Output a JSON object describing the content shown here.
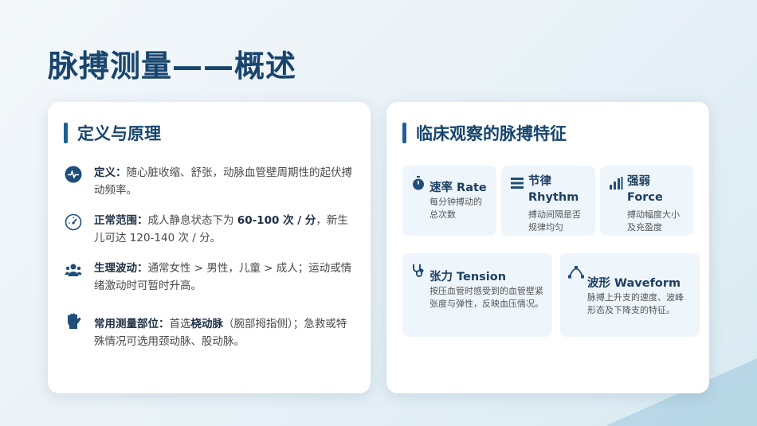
{
  "page": {
    "title": "脉搏测量——概述"
  },
  "left_card": {
    "heading": "定义与原理",
    "items": [
      {
        "icon": "heartbeat-icon",
        "label": "定义：",
        "text": "随心脏收缩、舒张，动脉血管壁周期性的起伏搏动频率。"
      },
      {
        "icon": "gauge-icon",
        "label": "正常范围：",
        "text_a": "成人静息状态下为 ",
        "highlight": "60-100 次 / 分",
        "text_b": "，新生儿可达 120-140 次 / 分。"
      },
      {
        "icon": "users-icon",
        "label": "生理波动：",
        "text": "通常女性 > 男性，儿童 > 成人；运动或情绪激动时可暂时升高。"
      },
      {
        "icon": "hand-icon",
        "label": "常用测量部位：",
        "text_a": "首选",
        "highlight": "桡动脉",
        "text_b": "（腕部拇指侧）；急救或特殊情况可选用颈动脉、股动脉。"
      }
    ]
  },
  "right_card": {
    "heading": "临床观察的脉搏特征",
    "features": [
      {
        "icon": "stopwatch-icon",
        "title": "速率 Rate",
        "desc": "每分钟搏动的总次数"
      },
      {
        "icon": "list-icon",
        "title": "节律 Rhythm",
        "desc": "搏动间隔是否规律均匀"
      },
      {
        "icon": "bar-chart-icon",
        "title": "强弱 Force",
        "desc": "搏动幅度大小及充盈度"
      },
      {
        "icon": "stethoscope-icon",
        "title": "张力 Tension",
        "desc": "按压血管时感受到的血管壁紧张度与弹性，反映血压情况。"
      },
      {
        "icon": "curve-icon",
        "title": "波形 Waveform",
        "desc": "脉搏上升支的速度、波峰形态及下降支的特征。"
      }
    ]
  },
  "colors": {
    "primary": "#18456e",
    "accent": "#1f5f96",
    "feature_bg": "#eef6fc"
  }
}
